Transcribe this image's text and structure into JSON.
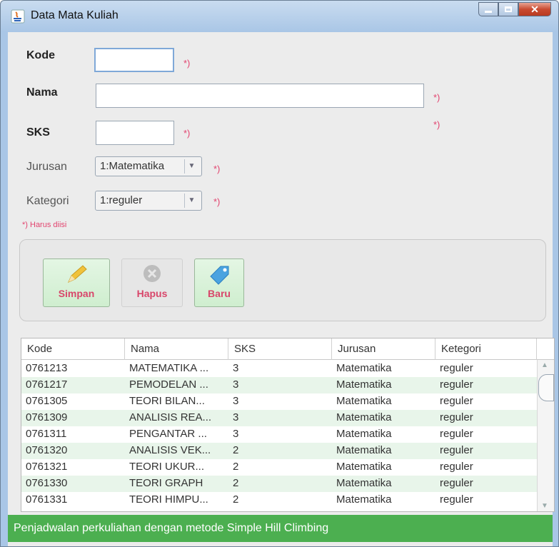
{
  "window": {
    "title": "Data Mata Kuliah",
    "icon": "java-icon"
  },
  "form": {
    "kode_label": "Kode",
    "nama_label": "Nama",
    "sks_label": "SKS",
    "jurusan_label": "Jurusan",
    "kategori_label": "Kategori",
    "required_mark": "*)",
    "kode_value": "",
    "nama_value": "",
    "sks_value": "",
    "jurusan_value": "1:Matematika",
    "kategori_value": "1:reguler",
    "note": "*) Harus diisi"
  },
  "buttons": {
    "simpan": "Simpan",
    "hapus": "Hapus",
    "baru": "Baru"
  },
  "table": {
    "headers": [
      "Kode",
      "Nama",
      "SKS",
      "Jurusan",
      "Ketegori"
    ],
    "rows": [
      [
        "0761213",
        "MATEMATIKA ...",
        "3",
        "Matematika",
        "reguler"
      ],
      [
        "0761217",
        "PEMODELAN ...",
        "3",
        "Matematika",
        "reguler"
      ],
      [
        "0761305",
        "TEORI BILAN...",
        "3",
        "Matematika",
        "reguler"
      ],
      [
        "0761309",
        "ANALISIS REA...",
        "3",
        "Matematika",
        "reguler"
      ],
      [
        "0761311",
        "PENGANTAR ...",
        "3",
        "Matematika",
        "reguler"
      ],
      [
        "0761320",
        "ANALISIS VEK...",
        "2",
        "Matematika",
        "reguler"
      ],
      [
        "0761321",
        "TEORI UKUR...",
        "2",
        "Matematika",
        "reguler"
      ],
      [
        "0761330",
        "TEORI GRAPH",
        "2",
        "Matematika",
        "reguler"
      ],
      [
        "0761331",
        "TEORI HIMPU...",
        "2",
        "Matematika",
        "reguler"
      ]
    ]
  },
  "status": {
    "text": "Penjadwalan perkuliahan dengan metode Simple Hill Climbing"
  },
  "colors": {
    "accent": "#e2446f",
    "status_bar": "#4caf50",
    "row_alt": "#e8f5ea",
    "button_bg": "#d8f2d8"
  }
}
